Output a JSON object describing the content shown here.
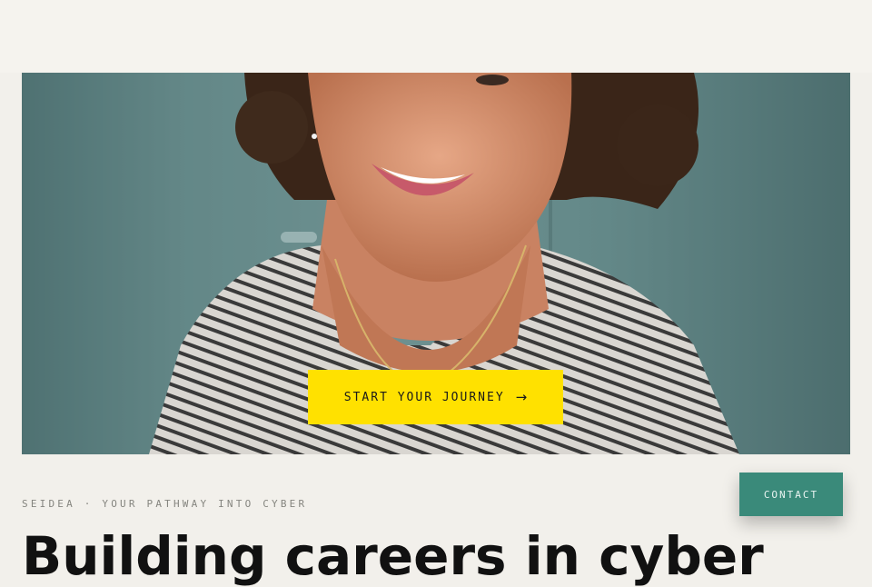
{
  "hero": {
    "image_alt": "smiling woman in striped top",
    "cta_label": "START YOUR JOURNEY",
    "cta_icon": "arrow-right-icon",
    "cta_arrow_glyph": "→",
    "cta_color": "#ffe100"
  },
  "intro": {
    "eyebrow": "SEIDEA · YOUR PATHWAY INTO CYBER",
    "headline": "Building careers in cyber"
  },
  "floating": {
    "contact_label": "CONTACT",
    "contact_color": "#3a8a7a"
  }
}
